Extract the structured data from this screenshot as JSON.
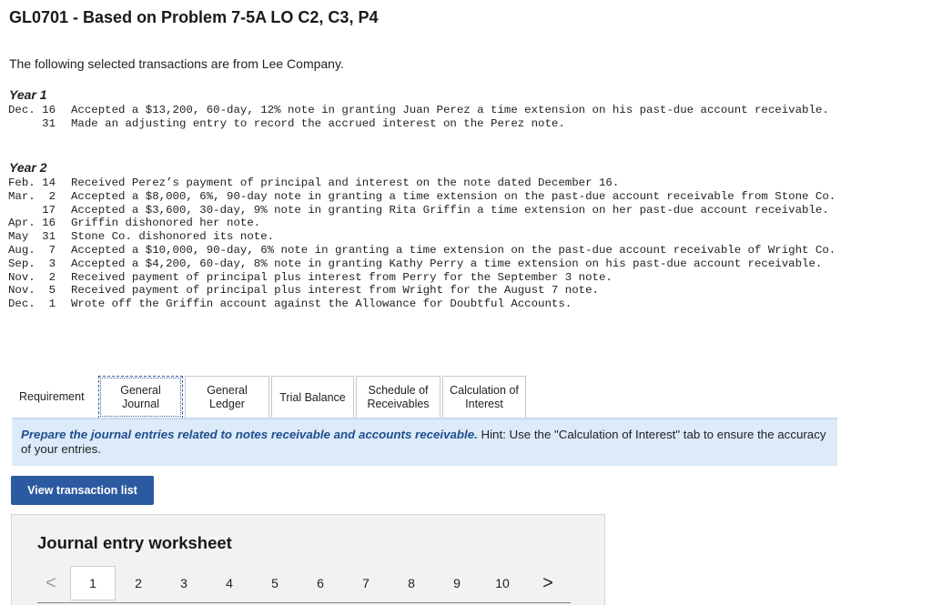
{
  "title": "GL0701 - Based on Problem 7-5A LO C2, C3, P4",
  "intro": "The following selected transactions are from Lee Company.",
  "year1": {
    "label": "Year 1",
    "transactions": [
      {
        "date": "Dec. 16",
        "text": "Accepted a $13,200, 60-day, 12% note in granting Juan Perez a time extension on his past-due account receivable."
      },
      {
        "date": "     31",
        "text": "Made an adjusting entry to record the accrued interest on the Perez note."
      }
    ]
  },
  "year2": {
    "label": "Year 2",
    "transactions": [
      {
        "date": "Feb. 14",
        "text": "Received Perez’s payment of principal and interest on the note dated December 16."
      },
      {
        "date": "Mar.  2",
        "text": "Accepted a $8,000, 6%, 90-day note in granting a time extension on the past-due account receivable from Stone Co."
      },
      {
        "date": "     17",
        "text": "Accepted a $3,600, 30-day, 9% note in granting Rita Griffin a time extension on her past-due account receivable."
      },
      {
        "date": "Apr. 16",
        "text": "Griffin dishonored her note."
      },
      {
        "date": "May  31",
        "text": "Stone Co. dishonored its note."
      },
      {
        "date": "Aug.  7",
        "text": "Accepted a $10,000, 90-day, 6% note in granting a time extension on the past-due account receivable of Wright Co."
      },
      {
        "date": "Sep.  3",
        "text": "Accepted a $4,200, 60-day, 8% note in granting Kathy Perry a time extension on his past-due account receivable."
      },
      {
        "date": "Nov.  2",
        "text": "Received payment of principal plus interest from Perry for the September 3 note."
      },
      {
        "date": "Nov.  5",
        "text": "Received payment of principal plus interest from Wright for the August 7 note."
      },
      {
        "date": "Dec.  1",
        "text": "Wrote off the Griffin account against the Allowance for Doubtful Accounts."
      }
    ]
  },
  "tabs": [
    {
      "line1": "Requirement",
      "line2": ""
    },
    {
      "line1": "General",
      "line2": "Journal"
    },
    {
      "line1": "General",
      "line2": "Ledger"
    },
    {
      "line1": "Trial Balance",
      "line2": ""
    },
    {
      "line1": "Schedule of",
      "line2": "Receivables"
    },
    {
      "line1": "Calculation of",
      "line2": "Interest"
    }
  ],
  "hint": {
    "emphasis": "Prepare the journal entries related to notes receivable and accounts receivable.",
    "rest": " Hint:  Use the \"Calculation of Interest\" tab to ensure the accuracy of your entries."
  },
  "view_button": "View transaction list",
  "worksheet": {
    "title": "Journal entry worksheet",
    "prev_arrow": "<",
    "next_arrow": ">",
    "pages": [
      "1",
      "2",
      "3",
      "4",
      "5",
      "6",
      "7",
      "8",
      "9",
      "10"
    ]
  }
}
